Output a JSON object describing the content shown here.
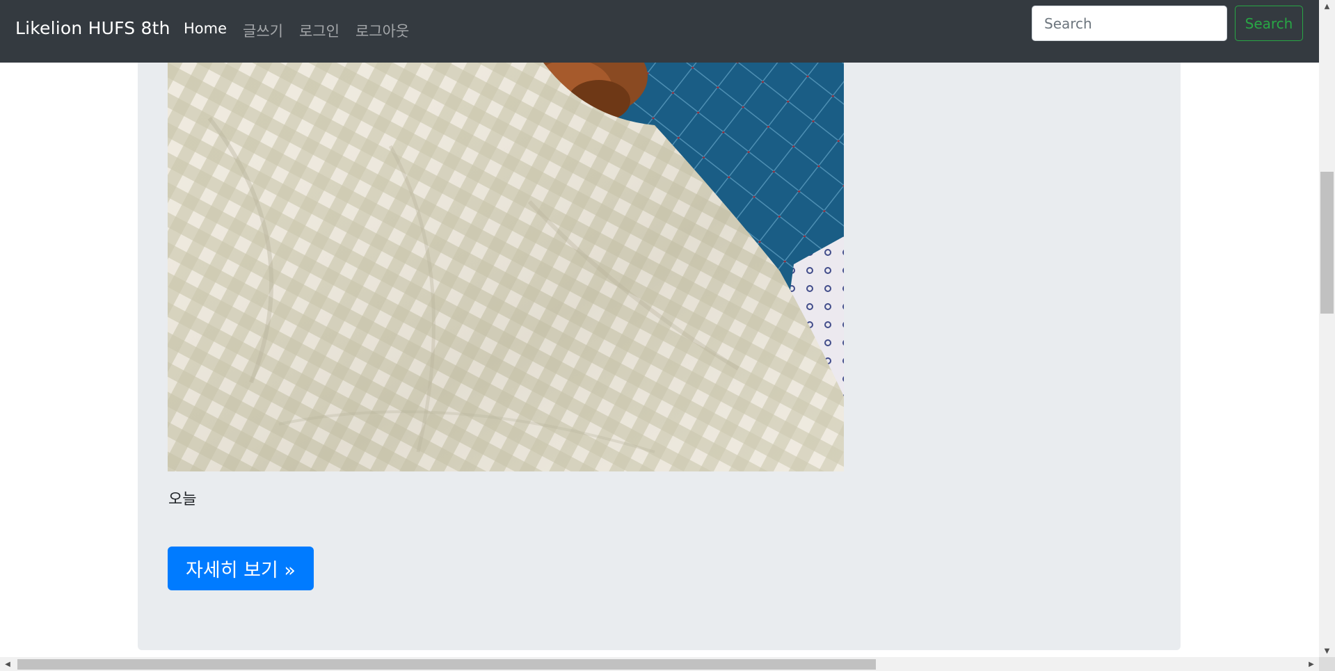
{
  "navbar": {
    "brand": "Likelion HUFS 8th",
    "links": [
      {
        "label": "Home",
        "active": true
      },
      {
        "label": "글쓰기",
        "active": false
      },
      {
        "label": "로그인",
        "active": false
      },
      {
        "label": "로그아웃",
        "active": false
      }
    ],
    "search": {
      "placeholder": "Search",
      "button_label": "Search"
    }
  },
  "post": {
    "text": "오늘",
    "detail_button_label": "자세히 보기 »"
  },
  "colors": {
    "navbar_bg": "#343a40",
    "jumbotron_bg": "#e9ecef",
    "primary": "#007bff",
    "success": "#28a745"
  }
}
